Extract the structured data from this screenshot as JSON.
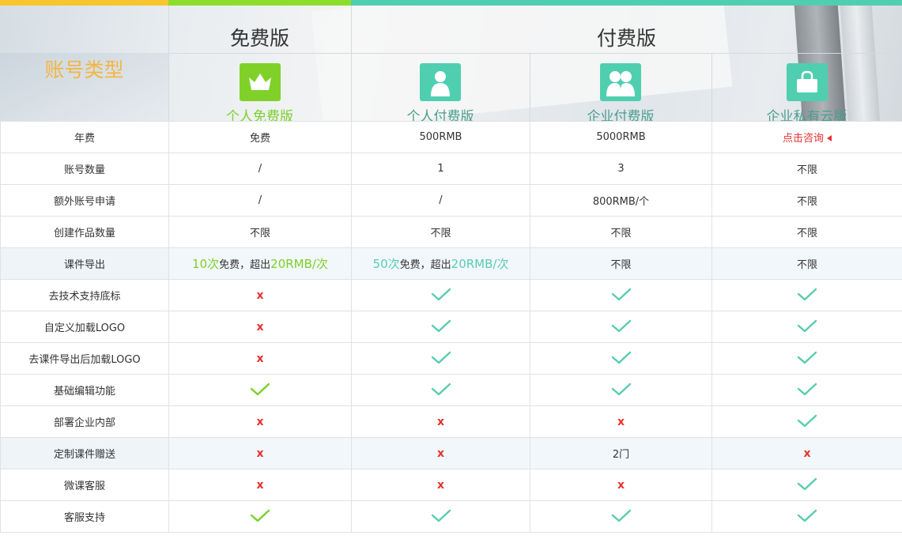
{
  "colors": {
    "strip_yellow": "#f7c52e",
    "strip_lime": "#8cde2a",
    "strip_teal": "#4fcfb0",
    "account_type": "#f3b541",
    "check_teal": "#58cdb0",
    "check_lime": "#7bd12a",
    "cross_red": "#e8302f"
  },
  "header": {
    "account_type": "账号类型",
    "free_tier": "免费版",
    "paid_tier": "付费版",
    "plans": [
      {
        "label": "个人免费版",
        "icon": "crown-icon",
        "color": "#7fd12a",
        "text_color": "#7bd12a"
      },
      {
        "label": "个人付费版",
        "icon": "person-icon",
        "color": "#4fcfb0",
        "text_color": "#4a9e8c"
      },
      {
        "label": "企业付费版",
        "icon": "group-icon",
        "color": "#4fcfb0",
        "text_color": "#4a9e8c"
      },
      {
        "label": "企业私有云版",
        "icon": "bag-icon",
        "color": "#4fcfb0",
        "text_color": "#4a9e8c"
      }
    ]
  },
  "rows": [
    {
      "feature": "年费",
      "cells": [
        {
          "t": "text",
          "v": "免费"
        },
        {
          "t": "text",
          "v": "500RMB"
        },
        {
          "t": "text",
          "v": "5000RMB"
        },
        {
          "t": "consult",
          "v": "点击咨询"
        }
      ]
    },
    {
      "feature": "账号数量",
      "cells": [
        {
          "t": "text",
          "v": "/"
        },
        {
          "t": "text",
          "v": "1"
        },
        {
          "t": "text",
          "v": "3"
        },
        {
          "t": "text",
          "v": "不限"
        }
      ]
    },
    {
      "feature": "额外账号申请",
      "cells": [
        {
          "t": "text",
          "v": "/"
        },
        {
          "t": "text",
          "v": "/"
        },
        {
          "t": "text",
          "v": "800RMB/个"
        },
        {
          "t": "text",
          "v": "不限"
        }
      ]
    },
    {
      "feature": "创建作品数量",
      "cells": [
        {
          "t": "text",
          "v": "不限"
        },
        {
          "t": "text",
          "v": "不限"
        },
        {
          "t": "text",
          "v": "不限"
        },
        {
          "t": "text",
          "v": "不限"
        }
      ]
    },
    {
      "feature": "课件导出",
      "alt": true,
      "cells": [
        {
          "t": "rich",
          "parts": [
            {
              "v": "10次",
              "c": "lime"
            },
            {
              "v": "免费，超出",
              "c": ""
            },
            {
              "v": "20RMB/次",
              "c": "lime"
            }
          ]
        },
        {
          "t": "rich",
          "parts": [
            {
              "v": "50次",
              "c": "teal"
            },
            {
              "v": "免费，超出",
              "c": ""
            },
            {
              "v": "20RMB/次",
              "c": "teal"
            }
          ]
        },
        {
          "t": "text",
          "v": "不限"
        },
        {
          "t": "text",
          "v": "不限"
        }
      ]
    },
    {
      "feature": "去技术支持底标",
      "cells": [
        {
          "t": "no"
        },
        {
          "t": "yes"
        },
        {
          "t": "yes"
        },
        {
          "t": "yes"
        }
      ]
    },
    {
      "feature": "自定义加载LOGO",
      "cells": [
        {
          "t": "no"
        },
        {
          "t": "yes"
        },
        {
          "t": "yes"
        },
        {
          "t": "yes"
        }
      ]
    },
    {
      "feature": "去课件导出后加载LOGO",
      "cells": [
        {
          "t": "no"
        },
        {
          "t": "yes"
        },
        {
          "t": "yes"
        },
        {
          "t": "yes"
        }
      ]
    },
    {
      "feature": "基础编辑功能",
      "cells": [
        {
          "t": "yes-lime"
        },
        {
          "t": "yes"
        },
        {
          "t": "yes"
        },
        {
          "t": "yes"
        }
      ]
    },
    {
      "feature": "部署企业内部",
      "cells": [
        {
          "t": "no"
        },
        {
          "t": "no"
        },
        {
          "t": "no"
        },
        {
          "t": "yes"
        }
      ]
    },
    {
      "feature": "定制课件赠送",
      "alt": true,
      "cells": [
        {
          "t": "no"
        },
        {
          "t": "no"
        },
        {
          "t": "text",
          "v": "2门"
        },
        {
          "t": "no"
        }
      ]
    },
    {
      "feature": "微课客服",
      "cells": [
        {
          "t": "no"
        },
        {
          "t": "no"
        },
        {
          "t": "no"
        },
        {
          "t": "yes"
        }
      ]
    },
    {
      "feature": "客服支持",
      "cells": [
        {
          "t": "yes-lime"
        },
        {
          "t": "yes"
        },
        {
          "t": "yes"
        },
        {
          "t": "yes"
        }
      ]
    }
  ],
  "symbols": {
    "no": "x"
  }
}
